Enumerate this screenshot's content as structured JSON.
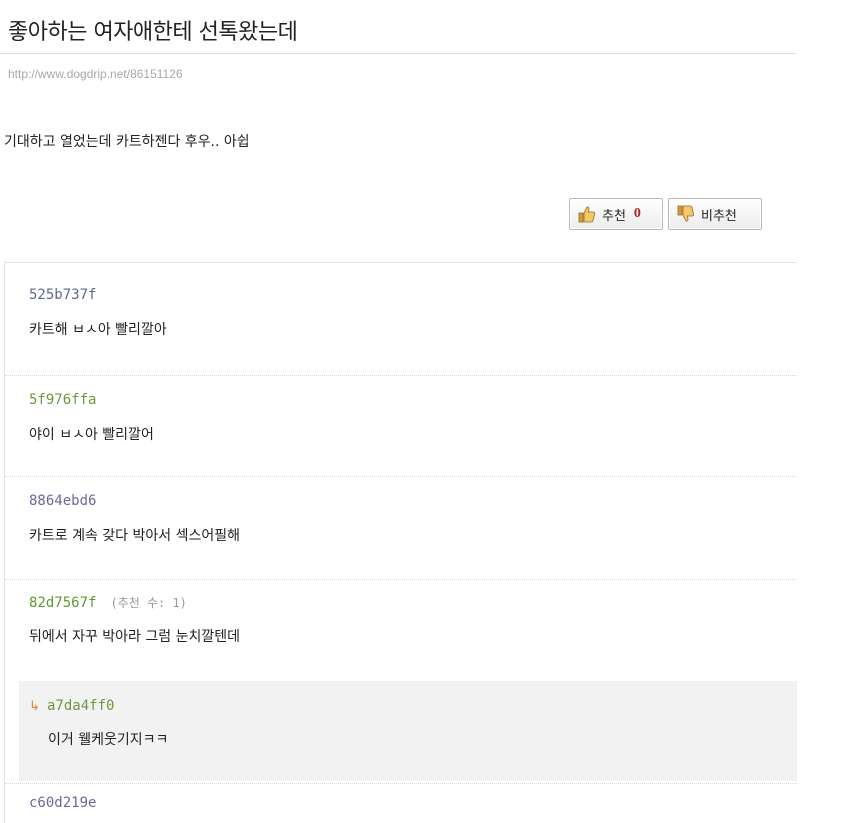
{
  "post": {
    "title": "좋아하는 여자애한테 선톡왔는데",
    "url": "http://www.dogdrip.net/86151126",
    "body": "기대하고 열었는데 카트하젠다 후우.. 아쉽"
  },
  "votes": {
    "up_label": "추천",
    "up_count": "0",
    "down_label": "비추천"
  },
  "comments": [
    {
      "author": "525b737f",
      "color": "#5a6b8a",
      "votes": "",
      "text": "카트해 ㅂㅅ아 빨리깔아"
    },
    {
      "author": "5f976ffa",
      "color": "#6b9a3e",
      "votes": "",
      "text": "야이 ㅂㅅ아 빨리깔어"
    },
    {
      "author": "8864ebd6",
      "color": "#6a6a9a",
      "votes": "",
      "text": "카트로 계속 갖다 박아서 섹스어필해"
    },
    {
      "author": "82d7567f",
      "color": "#5c9a2e",
      "votes": "(추천 수: 1)",
      "text": "뒤에서 자꾸 박아라 그럼 눈치깔텐데"
    }
  ],
  "reply": {
    "arrow": "↳",
    "author": "a7da4ff0",
    "color": "#6b9a3e",
    "text": "이거 웰케웃기지ㅋㅋ"
  },
  "partial_comment": {
    "author": "c60d219e",
    "color": "#6a6a9a"
  }
}
